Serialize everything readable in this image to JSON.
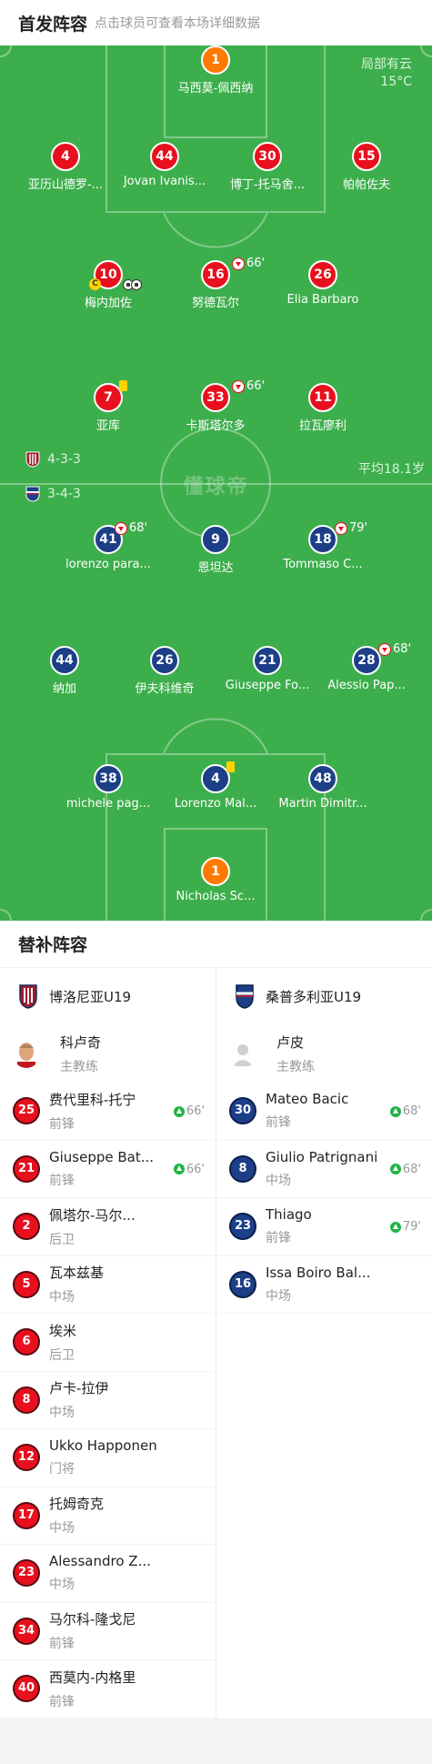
{
  "header": {
    "title": "首发阵容",
    "hint": "点击球员可查看本场详细数据"
  },
  "weather": {
    "condition": "局部有云",
    "temp": "15°C"
  },
  "watermark": "懂球帝",
  "home": {
    "formation": "4-3-3",
    "avg_age": "平均18.1岁",
    "gk": {
      "num": "1",
      "name": "马西莫-佩西纳"
    },
    "def": [
      {
        "num": "4",
        "name": "亚历山德罗-..."
      },
      {
        "num": "44",
        "name": "Jovan Ivanis..."
      },
      {
        "num": "30",
        "name": "博丁-托马舍..."
      },
      {
        "num": "15",
        "name": "帕帕佐夫"
      }
    ],
    "mid": [
      {
        "num": "10",
        "name": "梅内加佐"
      },
      {
        "num": "16",
        "name": "努德瓦尔",
        "sub": "66'"
      },
      {
        "num": "26",
        "name": "Elia Barbaro"
      }
    ],
    "att": [
      {
        "num": "7",
        "name": "亚库"
      },
      {
        "num": "33",
        "name": "卡斯塔尔多",
        "sub": "66'"
      },
      {
        "num": "11",
        "name": "拉瓦廖利"
      }
    ]
  },
  "away": {
    "formation": "3-4-3",
    "att": [
      {
        "num": "41",
        "name": "lorenzo para...",
        "sub": "68'"
      },
      {
        "num": "9",
        "name": "恩坦达"
      },
      {
        "num": "18",
        "name": "Tommaso C...",
        "sub": "79'"
      }
    ],
    "mid": [
      {
        "num": "44",
        "name": "纳加"
      },
      {
        "num": "26",
        "name": "伊夫科维奇"
      },
      {
        "num": "21",
        "name": "Giuseppe Fo..."
      },
      {
        "num": "28",
        "name": "Alessio Pap...",
        "sub": "68'"
      }
    ],
    "def": [
      {
        "num": "38",
        "name": "michele pag..."
      },
      {
        "num": "4",
        "name": "Lorenzo Mal..."
      },
      {
        "num": "48",
        "name": "Martin Dimitr..."
      }
    ],
    "gk": {
      "num": "1",
      "name": "Nicholas Sc..."
    }
  },
  "bench": {
    "title": "替补阵容",
    "home_team": "博洛尼亚U19",
    "away_team": "桑普多利亚U19",
    "home_coach": {
      "name": "科卢奇",
      "role": "主教练"
    },
    "away_coach": {
      "name": "卢皮",
      "role": "主教练"
    },
    "home_subs": [
      {
        "num": "25",
        "name": "费代里科-托宁",
        "pos": "前锋",
        "in": "66'"
      },
      {
        "num": "21",
        "name": "Giuseppe Bat...",
        "pos": "前锋",
        "in": "66'"
      },
      {
        "num": "2",
        "name": "佩塔尔-马尔...",
        "pos": "后卫"
      },
      {
        "num": "5",
        "name": "瓦本兹基",
        "pos": "中场"
      },
      {
        "num": "6",
        "name": "埃米",
        "pos": "后卫"
      },
      {
        "num": "8",
        "name": "卢卡-拉伊",
        "pos": "中场"
      },
      {
        "num": "12",
        "name": "Ukko Happonen",
        "pos": "门将"
      },
      {
        "num": "17",
        "name": "托姆奇克",
        "pos": "中场"
      },
      {
        "num": "23",
        "name": "Alessandro Z...",
        "pos": "中场"
      },
      {
        "num": "34",
        "name": "马尔科-隆戈尼",
        "pos": "前锋"
      },
      {
        "num": "40",
        "name": "西莫内-内格里",
        "pos": "前锋"
      }
    ],
    "away_subs": [
      {
        "num": "30",
        "name": "Mateo Bacic",
        "pos": "前锋",
        "in": "68'"
      },
      {
        "num": "8",
        "name": "Giulio Patrignani",
        "pos": "中场",
        "in": "68'"
      },
      {
        "num": "23",
        "name": "Thiago",
        "pos": "前锋",
        "in": "79'"
      },
      {
        "num": "16",
        "name": "Issa Boiro Bal...",
        "pos": "中场"
      }
    ]
  },
  "colors": {
    "home": "#e8101e",
    "away": "#1c3f88",
    "pitch": "#3dae4c",
    "keeper_home": "#ff7a00"
  }
}
